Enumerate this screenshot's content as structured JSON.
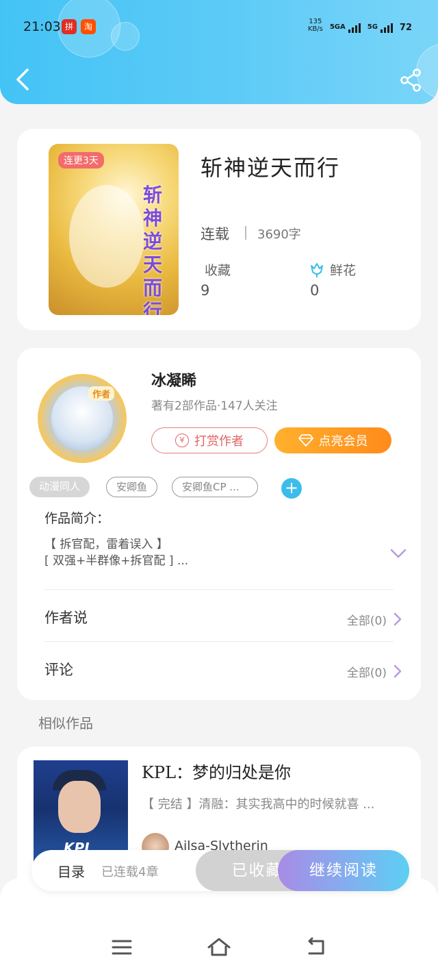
{
  "status_bar": {
    "time": "21:03",
    "net_speed_value": "135",
    "net_speed_unit": "KB/s",
    "signal_1_label": "5GA",
    "signal_2_label": "5G",
    "battery": "72"
  },
  "app_badges": {
    "pinduoduo": "拼",
    "taobao": "淘"
  },
  "header": {
    "back_icon": "chevron-left-icon",
    "share_icon": "share-icon"
  },
  "book": {
    "title": "斩神逆天而行",
    "cover_tag": "连更3天",
    "cover_title": "斩神逆天而行",
    "status": "连载",
    "word_count": "3690字",
    "favorites_label": "收藏",
    "favorites_value": "9",
    "flowers_label": "鲜花",
    "flowers_value": "0"
  },
  "author": {
    "badge": "作者",
    "name": "冰凝睎",
    "meta": "著有2部作品·147人关注",
    "tip_label": "打赏作者",
    "tip_coin": "¥",
    "vip_label": "点亮会员"
  },
  "tags": [
    "动漫同人",
    "安卿鱼",
    "安卿鱼CP ..."
  ],
  "intro": {
    "title": "作品简介：",
    "line1": "【 拆官配，雷着误入 】",
    "line2": "[ 双强+半群像+拆官配 ] ..."
  },
  "rows": {
    "author_says_label": "作者说",
    "author_says_value": "全部(0)",
    "comments_label": "评论",
    "comments_value": "全部(0)"
  },
  "similar": {
    "section_title": "相似作品",
    "title": "KPL：梦的归处是你",
    "desc": "【 完结 】清融：其实我高中的时候就喜 ...",
    "author": "Ailsa-Slytherin",
    "thumb_logo": "KPL"
  },
  "action_bar": {
    "toc_label": "目录",
    "toc_meta": "已连载4章",
    "collected_label": "已收藏",
    "read_label": "继续阅读"
  },
  "nav": {
    "menu_icon": "menu-icon",
    "home_icon": "home-icon",
    "back_icon": "return-icon"
  },
  "colors": {
    "header_gradient_start": "#43c3f5",
    "header_gradient_end": "#7ad5f8",
    "vip_orange": "#ff8b1a",
    "tip_red": "#e36464",
    "read_gradient_start": "#a88be6",
    "read_gradient_end": "#5cd0f3",
    "add_tag_blue": "#3cbde9"
  }
}
